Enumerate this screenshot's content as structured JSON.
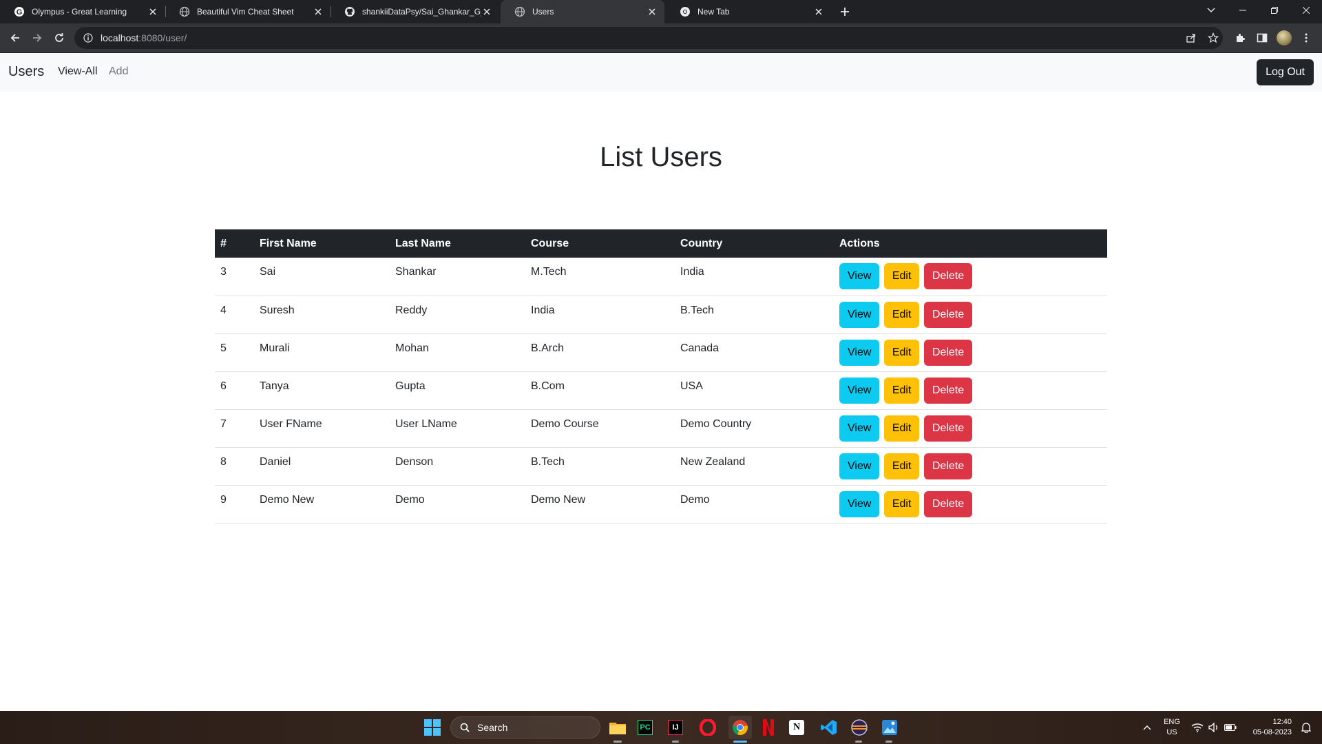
{
  "browser": {
    "tabs": [
      {
        "title": "Olympus - Great Learning",
        "icon": "google-g-icon",
        "active": false
      },
      {
        "title": "Beautiful Vim Cheat Sheet",
        "icon": "globe-icon",
        "active": false
      },
      {
        "title": "shankiiDataPsy/Sai_Ghankar_G_B",
        "icon": "github-icon",
        "active": false
      },
      {
        "title": "Users",
        "icon": "globe-icon",
        "active": true
      },
      {
        "title": "New Tab",
        "icon": "chrome-icon",
        "active": false
      }
    ],
    "url_host": "localhost",
    "url_rest": ":8080/user/"
  },
  "navbar": {
    "brand": "Users",
    "links": [
      {
        "label": "View-All"
      },
      {
        "label": "Add"
      }
    ],
    "logout_label": "Log Out"
  },
  "main": {
    "title": "List Users",
    "table": {
      "headers": [
        "#",
        "First Name",
        "Last Name",
        "Course",
        "Country",
        "Actions"
      ],
      "rows": [
        {
          "id": "3",
          "first": "Sai",
          "last": "Shankar",
          "course": "M.Tech",
          "country": "India"
        },
        {
          "id": "4",
          "first": "Suresh",
          "last": "Reddy",
          "course": "India",
          "country": "B.Tech"
        },
        {
          "id": "5",
          "first": "Murali",
          "last": "Mohan",
          "course": "B.Arch",
          "country": "Canada"
        },
        {
          "id": "6",
          "first": "Tanya",
          "last": "Gupta",
          "course": "B.Com",
          "country": "USA"
        },
        {
          "id": "7",
          "first": "User FName",
          "last": "User LName",
          "course": "Demo Course",
          "country": "Demo Country"
        },
        {
          "id": "8",
          "first": "Daniel",
          "last": "Denson",
          "course": "B.Tech",
          "country": "New Zealand"
        },
        {
          "id": "9",
          "first": "Demo New",
          "last": "Demo",
          "course": "Demo New",
          "country": "Demo"
        }
      ],
      "actions": {
        "view": "View",
        "edit": "Edit",
        "delete": "Delete"
      }
    }
  },
  "colors": {
    "view": "#0dcaf0",
    "edit": "#ffc107",
    "delete": "#dc3545",
    "table_header": "#212529"
  },
  "taskbar": {
    "search_label": "Search",
    "apps": [
      "file-explorer-icon",
      "pycharm-icon",
      "intellij-icon",
      "opera-icon",
      "chrome-icon",
      "netflix-icon",
      "notion-icon",
      "vscode-icon",
      "eclipse-icon",
      "photos-icon"
    ],
    "lang_top": "ENG",
    "lang_bottom": "US",
    "time": "12:40",
    "date": "05-08-2023"
  }
}
